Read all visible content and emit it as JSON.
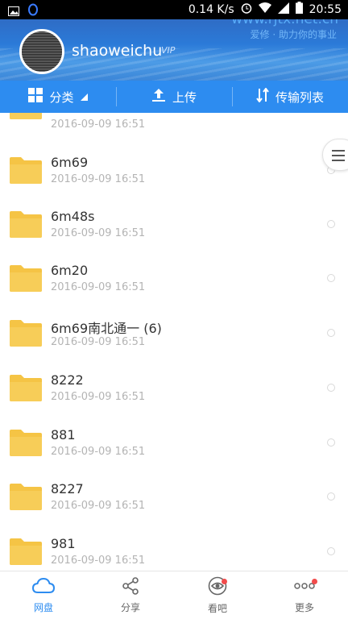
{
  "status_bar": {
    "speed": "0.14 K/s",
    "time": "20:55"
  },
  "header": {
    "username": "shaoweichu",
    "vip_badge": "VIP",
    "watermark_line1": "www.rjtx.net.cn",
    "watermark_line2": "爱修 · 助力你的事业"
  },
  "toolbar": {
    "category_label": "分类",
    "upload_label": "上传",
    "transfer_label": "传输列表"
  },
  "files": [
    {
      "name": "",
      "date": "2016-09-09  16:51"
    },
    {
      "name": "6m69",
      "date": "2016-09-09  16:51"
    },
    {
      "name": "6m48s",
      "date": "2016-09-09  16:51"
    },
    {
      "name": "6m20",
      "date": "2016-09-09  16:51"
    },
    {
      "name": "6m69南北通一 (6)",
      "date": "2016-09-09  16:51"
    },
    {
      "name": "8222",
      "date": "2016-09-09  16:51"
    },
    {
      "name": "881",
      "date": "2016-09-09  16:51"
    },
    {
      "name": "8227",
      "date": "2016-09-09  16:51"
    },
    {
      "name": "981",
      "date": "2016-09-09  16:51"
    }
  ],
  "bottom_nav": [
    {
      "label": "网盘",
      "icon": "cloud-icon",
      "active": true
    },
    {
      "label": "分享",
      "icon": "share-icon",
      "active": false
    },
    {
      "label": "看吧",
      "icon": "eye-icon",
      "active": false
    },
    {
      "label": "更多",
      "icon": "more-icon",
      "active": false
    }
  ],
  "colors": {
    "accent": "#2d8cf0",
    "folder": "#f5c445",
    "badge_dot": "#f24b4b"
  }
}
